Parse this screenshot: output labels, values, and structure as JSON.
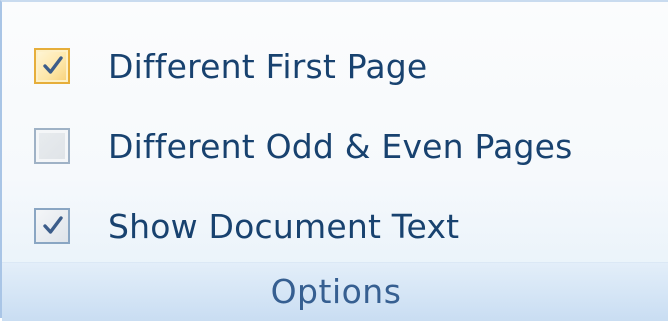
{
  "group": {
    "title": "Options",
    "options": [
      {
        "label": "Different First Page",
        "checked": true,
        "state": "hover"
      },
      {
        "label": "Different Odd & Even Pages",
        "checked": false,
        "state": "normal"
      },
      {
        "label": "Show Document Text",
        "checked": true,
        "state": "normal"
      }
    ]
  },
  "colors": {
    "label_text": "#18426f",
    "footer_text": "#365f91",
    "footer_background": "#d6e6f6",
    "hover_checkbox": "#fde6a7",
    "check_mark": "#3c5d8a"
  },
  "icons": {
    "check": "check-mark-icon"
  }
}
